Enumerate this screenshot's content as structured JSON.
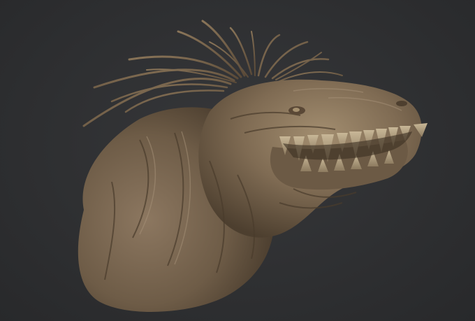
{
  "scene": {
    "subject": "creature-bust-sculpt",
    "colors": {
      "background": "#2f3032",
      "clay_base": "#7d6a52",
      "clay_light": "#a08b6e",
      "clay_dark": "#4a3c2c",
      "teeth": "#b8a78a"
    }
  }
}
